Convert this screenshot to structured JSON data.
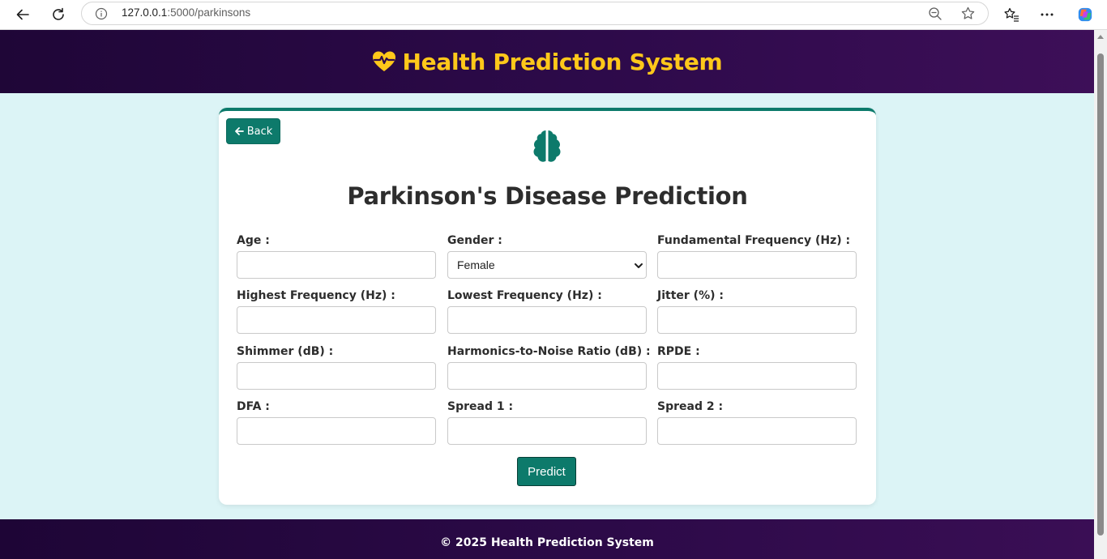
{
  "browser": {
    "url_host": "127.0.0.1",
    "url_path": ":5000/parkinsons"
  },
  "header": {
    "title": "Health Prediction System",
    "icon": "heartbeat-icon"
  },
  "card": {
    "back_label": "Back",
    "title": "Parkinson's Disease Prediction",
    "icon": "brain-icon",
    "fields": {
      "age": {
        "label": "Age :",
        "value": ""
      },
      "gender": {
        "label": "Gender :",
        "selected": "Female"
      },
      "fundamental_frequency": {
        "label": "Fundamental Frequency (Hz) :",
        "value": ""
      },
      "highest_frequency": {
        "label": "Highest Frequency (Hz) :",
        "value": ""
      },
      "lowest_frequency": {
        "label": "Lowest Frequency (Hz) :",
        "value": ""
      },
      "jitter": {
        "label": "Jitter (%) :",
        "value": ""
      },
      "shimmer": {
        "label": "Shimmer (dB) :",
        "value": ""
      },
      "hnr": {
        "label": "Harmonics-to-Noise Ratio (dB) :",
        "value": ""
      },
      "rpde": {
        "label": "RPDE :",
        "value": ""
      },
      "dfa": {
        "label": "DFA :",
        "value": ""
      },
      "spread1": {
        "label": "Spread 1 :",
        "value": ""
      },
      "spread2": {
        "label": "Spread 2 :",
        "value": ""
      }
    },
    "predict_label": "Predict"
  },
  "footer": {
    "text": "© 2025 Health Prediction System"
  },
  "colors": {
    "header_bg": "#2d0a4a",
    "title_accent": "#ffc81a",
    "primary": "#0d7a6b",
    "page_bg": "#dcf4f6"
  }
}
